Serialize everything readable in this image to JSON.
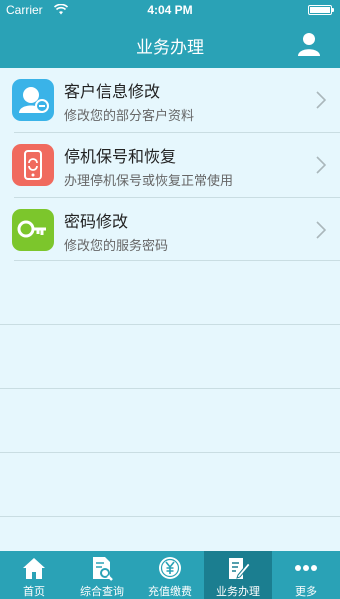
{
  "status": {
    "carrier": "Carrier",
    "time": "4:04 PM"
  },
  "header": {
    "title": "业务办理"
  },
  "items": [
    {
      "title": "客户信息修改",
      "subtitle": "修改您的部分客户资料",
      "icon": "customer-icon",
      "color": "#3ab3e8"
    },
    {
      "title": "停机保号和恢复",
      "subtitle": "办理停机保号或恢复正常使用",
      "icon": "phone-icon",
      "color": "#f06a5e"
    },
    {
      "title": "密码修改",
      "subtitle": "修改您的服务密码",
      "icon": "key-icon",
      "color": "#7cc62c"
    }
  ],
  "tabs": [
    {
      "label": "首页",
      "icon": "home-icon"
    },
    {
      "label": "综合查询",
      "icon": "query-icon"
    },
    {
      "label": "充值缴费",
      "icon": "yuan-icon"
    },
    {
      "label": "业务办理",
      "icon": "edit-icon",
      "active": true
    },
    {
      "label": "更多",
      "icon": "more-icon"
    }
  ],
  "colors": {
    "primary": "#2aa2b6",
    "background": "#e6f7fd",
    "active_tab": "#1b7e90"
  }
}
